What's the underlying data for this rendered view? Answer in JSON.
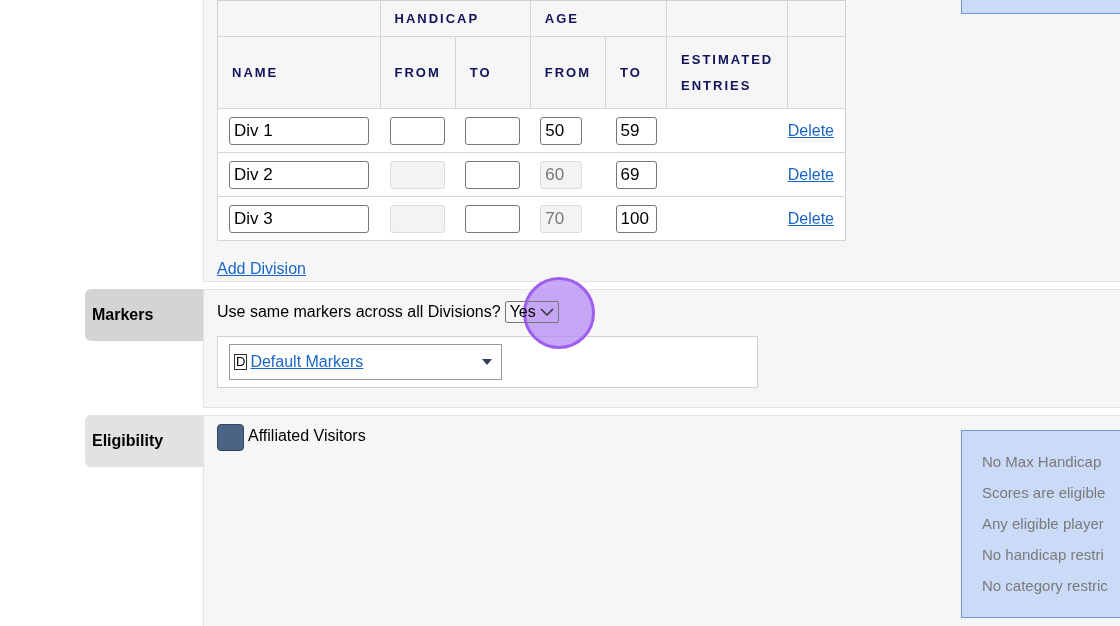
{
  "divisions_table": {
    "group_headers": [
      "HANDICAP",
      "AGE"
    ],
    "columns": [
      "NAME",
      "FROM",
      "TO",
      "FROM",
      "TO",
      "ESTIMATED ENTRIES"
    ],
    "rows": [
      {
        "name": "Div 1",
        "handicap_from": {
          "disabled": false
        },
        "handicap_to": {
          "disabled": false
        },
        "age_from": {
          "value": "50",
          "disabled": false
        },
        "age_to": {
          "value": "59",
          "disabled": false
        },
        "action": "Delete"
      },
      {
        "name": "Div 2",
        "handicap_from": {
          "disabled": true
        },
        "handicap_to": {
          "disabled": false
        },
        "age_from": {
          "value": "60",
          "disabled": true
        },
        "age_to": {
          "value": "69",
          "disabled": false
        },
        "action": "Delete"
      },
      {
        "name": "Div 3",
        "handicap_from": {
          "disabled": true
        },
        "handicap_to": {
          "disabled": false
        },
        "age_from": {
          "value": "70",
          "disabled": true
        },
        "age_to": {
          "value": "100",
          "disabled": false
        },
        "action": "Delete"
      }
    ]
  },
  "add_division": "Add Division",
  "markers": {
    "label": "Markers",
    "question": "Use same markers across all Divisions?",
    "answer": "Yes",
    "marker_badge": "D",
    "marker_link": "Default Markers"
  },
  "eligibility": {
    "label": "Eligibility",
    "checkbox": {
      "label": "Affiliated Visitors",
      "checked": true
    },
    "summary": [
      "No Max Handicap",
      "Scores are eligible",
      "Any eligible player",
      "No handicap restri",
      "No category restric"
    ]
  }
}
